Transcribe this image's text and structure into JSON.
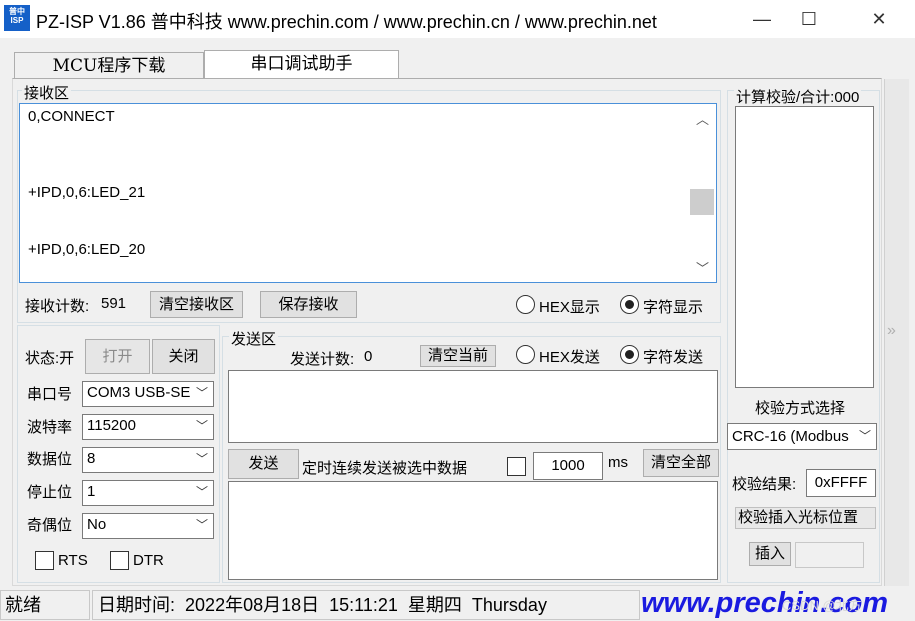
{
  "title": {
    "logo_text": "普中ISP",
    "text": "PZ-ISP V1.86 普中科技  www.prechin.com / www.prechin.cn / www.prechin.net",
    "min_icon": "—",
    "max_icon": "☐",
    "close_icon": "✕"
  },
  "tabs": [
    {
      "label": "MCU程序下载"
    },
    {
      "label": "串口调试助手"
    }
  ],
  "receive": {
    "group_label": "接收区",
    "lines": [
      "0,CONNECT",
      "+IPD,0,6:LED_21",
      "+IPD,0,6:LED_20"
    ],
    "count_label": "接收计数:",
    "count_value": "591",
    "clear_label": "清空接收区",
    "save_label": "保存接收",
    "hex_label": "HEX显示",
    "char_label": "字符显示"
  },
  "serial": {
    "status_label": "状态:开",
    "open_label": "打开",
    "close_label": "关闭",
    "port_label": "串口号",
    "port_value": "COM3  USB-SE",
    "baud_label": "波特率",
    "baud_value": "115200",
    "databits_label": "数据位",
    "databits_value": "8",
    "stopbits_label": "停止位",
    "stopbits_value": "1",
    "parity_label": "奇偶位",
    "parity_value": "No",
    "rts_label": "RTS",
    "dtr_label": "DTR"
  },
  "send": {
    "group_label": "发送区",
    "count_label": "发送计数:",
    "count_value": "0",
    "clear_current_label": "清空当前",
    "hex_label": "HEX发送",
    "char_label": "字符发送",
    "send_label": "发送",
    "timed_label": "定时连续发送被选中数据",
    "interval_value": "1000",
    "ms_label": "ms",
    "clear_all_label": "清空全部"
  },
  "checksum": {
    "header_label": "计算校验/合计:000",
    "method_label": "校验方式选择",
    "method_value": "CRC-16 (Modbus",
    "result_label": "校验结果:",
    "result_value": "0xFFFF",
    "insert_cursor_label": "校验插入光标位置",
    "insert_label": "插入"
  },
  "statusbar": {
    "ready": "就绪",
    "datetime_label": "日期时间:",
    "date": "2022年08月18日",
    "time": "15:11:21",
    "weekday": "星期四",
    "weekday_en": "Thursday",
    "brand": "www.prechin.com",
    "watermark": "CSDN @北方"
  },
  "colors": {
    "brand_blue": "#1a1ae0",
    "logo_blue": "#1560c8"
  }
}
